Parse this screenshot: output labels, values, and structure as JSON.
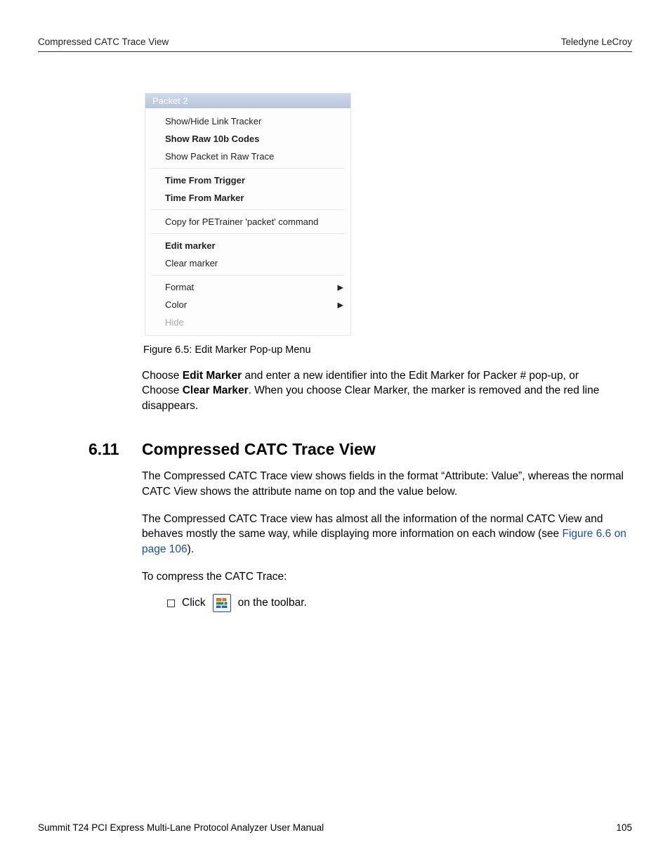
{
  "header": {
    "left": "Compressed CATC Trace View",
    "right": "Teledyne LeCroy"
  },
  "menu": {
    "title": "Packet 2",
    "items": [
      {
        "label": "Show/Hide Link Tracker",
        "bold": false,
        "disabled": false,
        "submenu": false
      },
      {
        "label": "Show Raw 10b Codes",
        "bold": true,
        "disabled": false,
        "submenu": false
      },
      {
        "label": "Show Packet in Raw Trace",
        "bold": false,
        "disabled": false,
        "submenu": false
      },
      {
        "sep": true
      },
      {
        "label": "Time From Trigger",
        "bold": true,
        "disabled": false,
        "submenu": false
      },
      {
        "label": "Time From Marker",
        "bold": true,
        "disabled": false,
        "submenu": false
      },
      {
        "sep": true
      },
      {
        "label": "Copy for PETrainer 'packet' command",
        "bold": false,
        "disabled": false,
        "submenu": false
      },
      {
        "sep": true
      },
      {
        "label": "Edit marker",
        "bold": true,
        "disabled": false,
        "submenu": false
      },
      {
        "label": "Clear marker",
        "bold": false,
        "disabled": false,
        "submenu": false
      },
      {
        "sep": true
      },
      {
        "label": "Format",
        "bold": false,
        "disabled": false,
        "submenu": true
      },
      {
        "label": "Color",
        "bold": false,
        "disabled": false,
        "submenu": true
      },
      {
        "label": "Hide",
        "bold": false,
        "disabled": true,
        "submenu": false
      }
    ]
  },
  "figure_caption": "Figure 6.5:  Edit Marker Pop-up Menu",
  "para1": {
    "pre1": "Choose ",
    "b1": "Edit Marker",
    "mid1": " and enter a new identifier into the Edit Marker for Packer # pop-up, or",
    "br": true,
    "pre2": "Choose ",
    "b2": "Clear Marker",
    "mid2": ". When you choose Clear Marker, the marker is removed and the red line disappears."
  },
  "section": {
    "num": "6.11",
    "title": "Compressed CATC Trace View"
  },
  "para2": "The Compressed CATC Trace view shows fields in the format “Attribute: Value”, whereas the normal CATC View shows the attribute name on top and the value below.",
  "para3": {
    "pre": "The Compressed CATC Trace view has almost all the information of the normal CATC View and behaves mostly the same way, while displaying more information on each window (see ",
    "link": "Figure 6.6 on page 106",
    "post": ")."
  },
  "para4": "To compress the CATC Trace:",
  "instr": {
    "pre": "Click ",
    "post": " on the toolbar."
  },
  "footer": {
    "left": "Summit T24 PCI Express Multi-Lane Protocol Analyzer User Manual",
    "right": "105"
  }
}
